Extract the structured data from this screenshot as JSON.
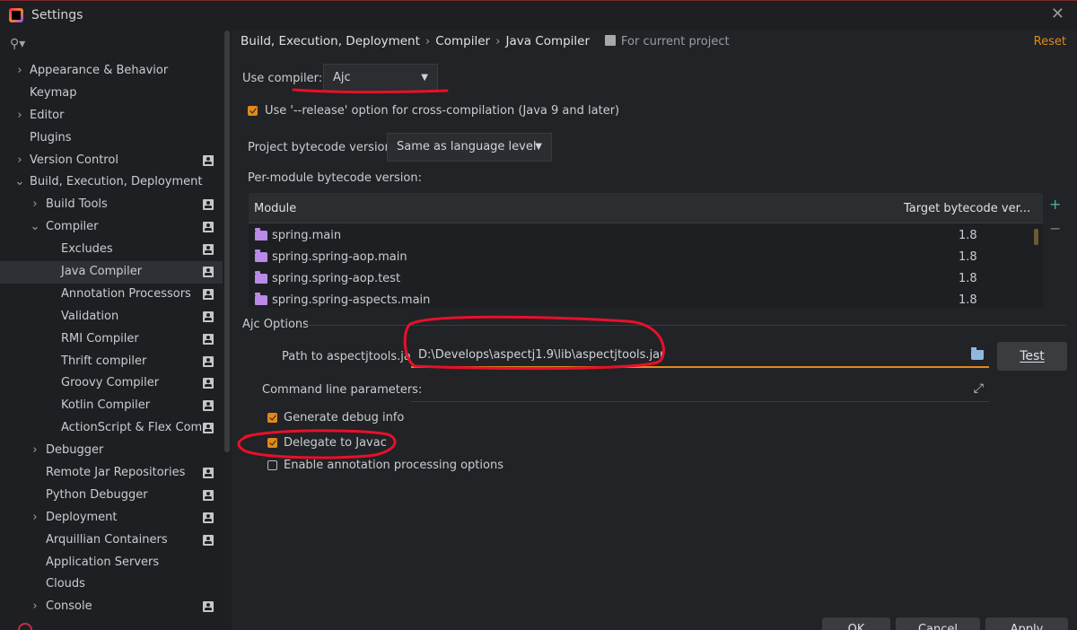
{
  "window": {
    "title": "Settings",
    "close_icon": "close-icon"
  },
  "sidebar": {
    "items": [
      {
        "label": "Appearance & Behavior",
        "level": 0,
        "chevron": "›",
        "project": false
      },
      {
        "label": "Keymap",
        "level": 0,
        "chevron": "",
        "project": false
      },
      {
        "label": "Editor",
        "level": 0,
        "chevron": "›",
        "project": false
      },
      {
        "label": "Plugins",
        "level": 0,
        "chevron": "",
        "project": false
      },
      {
        "label": "Version Control",
        "level": 0,
        "chevron": "›",
        "project": true
      },
      {
        "label": "Build, Execution, Deployment",
        "level": 0,
        "chevron": "⌄",
        "project": false
      },
      {
        "label": "Build Tools",
        "level": 1,
        "chevron": "›",
        "project": true
      },
      {
        "label": "Compiler",
        "level": 1,
        "chevron": "⌄",
        "project": true
      },
      {
        "label": "Excludes",
        "level": 2,
        "chevron": "",
        "project": true
      },
      {
        "label": "Java Compiler",
        "level": 2,
        "chevron": "",
        "project": true,
        "selected": true
      },
      {
        "label": "Annotation Processors",
        "level": 2,
        "chevron": "",
        "project": true
      },
      {
        "label": "Validation",
        "level": 2,
        "chevron": "",
        "project": true
      },
      {
        "label": "RMI Compiler",
        "level": 2,
        "chevron": "",
        "project": true
      },
      {
        "label": "Thrift compiler",
        "level": 2,
        "chevron": "",
        "project": true
      },
      {
        "label": "Groovy Compiler",
        "level": 2,
        "chevron": "",
        "project": true
      },
      {
        "label": "Kotlin Compiler",
        "level": 2,
        "chevron": "",
        "project": true
      },
      {
        "label": "ActionScript & Flex Comp",
        "level": 2,
        "chevron": "",
        "project": true
      },
      {
        "label": "Debugger",
        "level": 1,
        "chevron": "›",
        "project": false
      },
      {
        "label": "Remote Jar Repositories",
        "level": 1,
        "chevron": "",
        "project": true
      },
      {
        "label": "Python Debugger",
        "level": 1,
        "chevron": "",
        "project": true
      },
      {
        "label": "Deployment",
        "level": 1,
        "chevron": "›",
        "project": true
      },
      {
        "label": "Arquillian Containers",
        "level": 1,
        "chevron": "",
        "project": true
      },
      {
        "label": "Application Servers",
        "level": 1,
        "chevron": "",
        "project": false
      },
      {
        "label": "Clouds",
        "level": 1,
        "chevron": "",
        "project": false
      },
      {
        "label": "Console",
        "level": 1,
        "chevron": "›",
        "project": true
      }
    ]
  },
  "header": {
    "breadcrumb": [
      "Build, Execution, Deployment",
      "Compiler",
      "Java Compiler"
    ],
    "separator": "›",
    "scope": "For current project",
    "reset": "Reset"
  },
  "form": {
    "use_compiler_label": "Use compiler:",
    "use_compiler_value": "Ajc",
    "release_option_label": "Use '--release' option for cross-compilation (Java 9 and later)",
    "release_option_checked": true,
    "bytecode_label": "Project bytecode version:",
    "bytecode_value": "Same as language level",
    "per_module_label": "Per-module bytecode version:"
  },
  "module_table": {
    "columns": [
      "Module",
      "Target bytecode ver..."
    ],
    "rows": [
      {
        "module": "spring.main",
        "version": "1.8"
      },
      {
        "module": "spring.spring-aop.main",
        "version": "1.8"
      },
      {
        "module": "spring.spring-aop.test",
        "version": "1.8"
      },
      {
        "module": "spring.spring-aspects.main",
        "version": "1.8"
      }
    ],
    "add_label": "+",
    "remove_label": "−"
  },
  "ajc": {
    "group_title": "Ajc Options",
    "path_label": "Path to aspectjtools.jar:",
    "path_value": "D:\\Develops\\aspectj1.9\\lib\\aspectjtools.jar",
    "test_button": "Test",
    "cmd_label": "Command line parameters:",
    "cmd_value": "",
    "options": [
      {
        "label": "Generate debug info",
        "checked": true
      },
      {
        "label": "Delegate to Javac",
        "checked": true
      },
      {
        "label": "Enable annotation processing options",
        "checked": false
      }
    ]
  },
  "footer": {
    "buttons": [
      "OK",
      "Cancel",
      "Apply"
    ]
  },
  "colors": {
    "accent": "#e0891b",
    "annotation": "#e8102a",
    "selected_row": "#2e3035"
  }
}
